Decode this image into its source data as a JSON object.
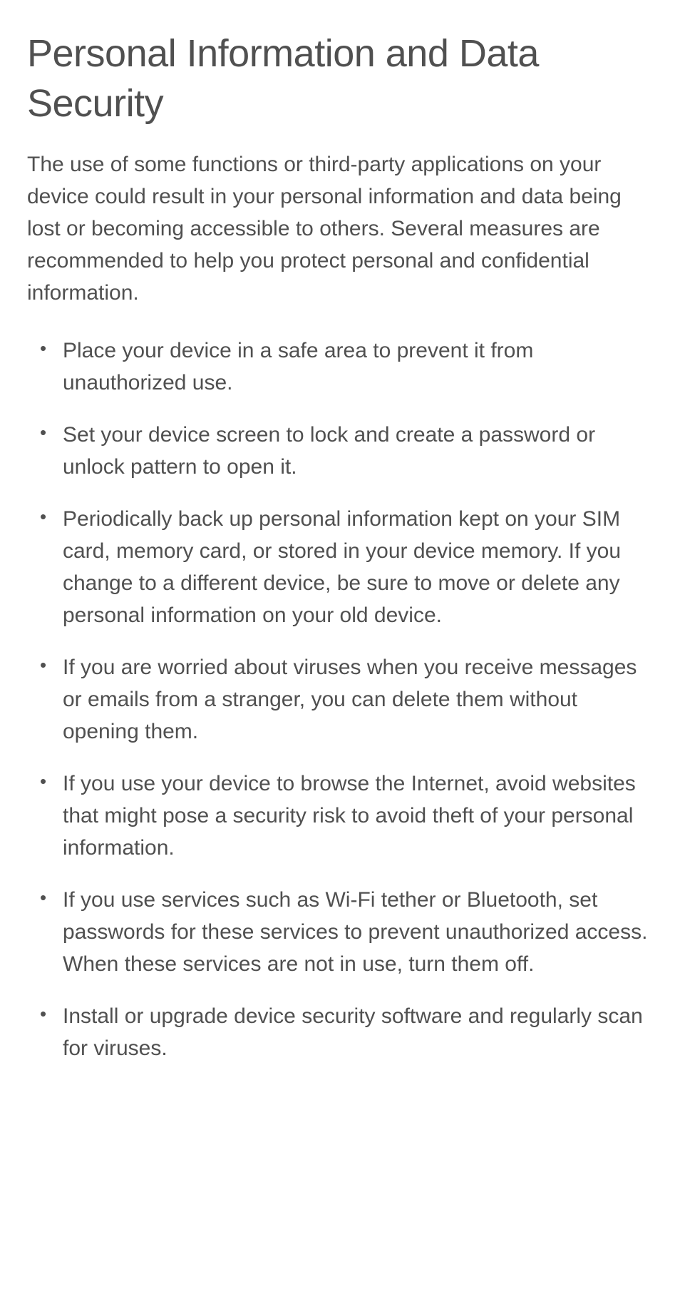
{
  "title": "Personal Information and Data Security",
  "intro": "The use of some functions or third-party applications on your device could result in your personal information and data being lost or becoming accessible to others. Several measures are recommended to help you protect personal and confidential information.",
  "items": [
    "Place your device in a safe area to prevent it from unauthorized use.",
    "Set your device screen to lock and create a password or unlock pattern to open it.",
    "Periodically back up personal information kept on your SIM card, memory card, or stored in your device memory. If you change to a different device, be sure to move or delete any personal information on your old device.",
    "If you are worried about viruses when you receive messages or emails from a stranger, you can delete them without opening them.",
    "If you use your device to browse the Internet, avoid websites that might pose a security risk to avoid theft of your personal information.",
    "If you use services such as Wi-Fi tether or Bluetooth, set passwords for these services to prevent unauthorized access. When these services are not in use, turn them off.",
    "Install or upgrade device security software and regularly scan for viruses."
  ]
}
